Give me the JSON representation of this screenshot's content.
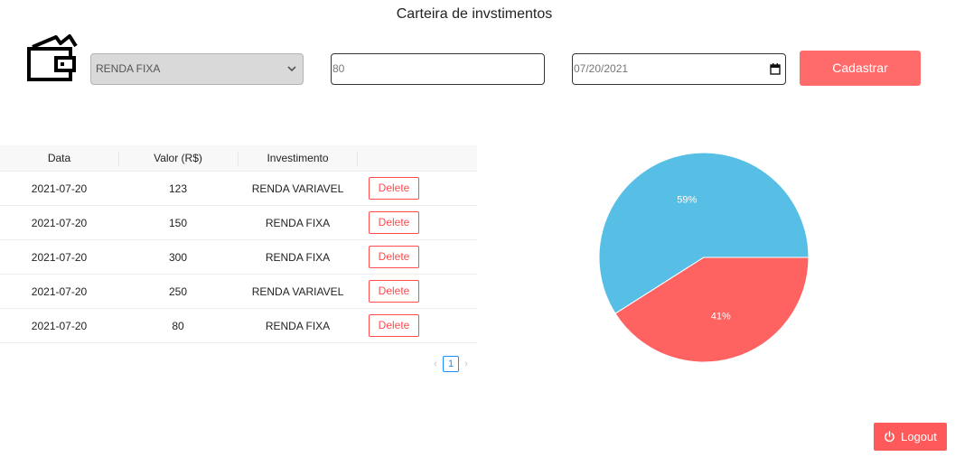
{
  "header": {
    "title": "Carteira de invstimentos"
  },
  "form": {
    "type_selected": "RENDA FIXA",
    "value": "80",
    "date": "07/20/2021",
    "submit_label": "Cadastrar"
  },
  "table": {
    "columns": [
      "Data",
      "Valor (R$)",
      "Investimento",
      ""
    ],
    "rows": [
      {
        "date": "2021-07-20",
        "value": "123",
        "type": "RENDA VARIAVEL",
        "action": "Delete"
      },
      {
        "date": "2021-07-20",
        "value": "150",
        "type": "RENDA FIXA",
        "action": "Delete"
      },
      {
        "date": "2021-07-20",
        "value": "300",
        "type": "RENDA FIXA",
        "action": "Delete"
      },
      {
        "date": "2021-07-20",
        "value": "250",
        "type": "RENDA VARIAVEL",
        "action": "Delete"
      },
      {
        "date": "2021-07-20",
        "value": "80",
        "type": "RENDA FIXA",
        "action": "Delete"
      }
    ]
  },
  "pagination": {
    "current_page": "1",
    "prev_icon": "chevron-left-icon",
    "next_icon": "chevron-right-icon"
  },
  "chart_data": {
    "type": "pie",
    "slices": [
      {
        "label": "59%",
        "value": 59,
        "color": "#57bfe6"
      },
      {
        "label": "41%",
        "value": 41,
        "color": "#ff6361"
      }
    ]
  },
  "logout": {
    "label": "Logout",
    "icon": "power-icon"
  },
  "colors": {
    "accent": "#ff6b6b",
    "danger": "#ff4d4f",
    "link": "#1890ff"
  }
}
